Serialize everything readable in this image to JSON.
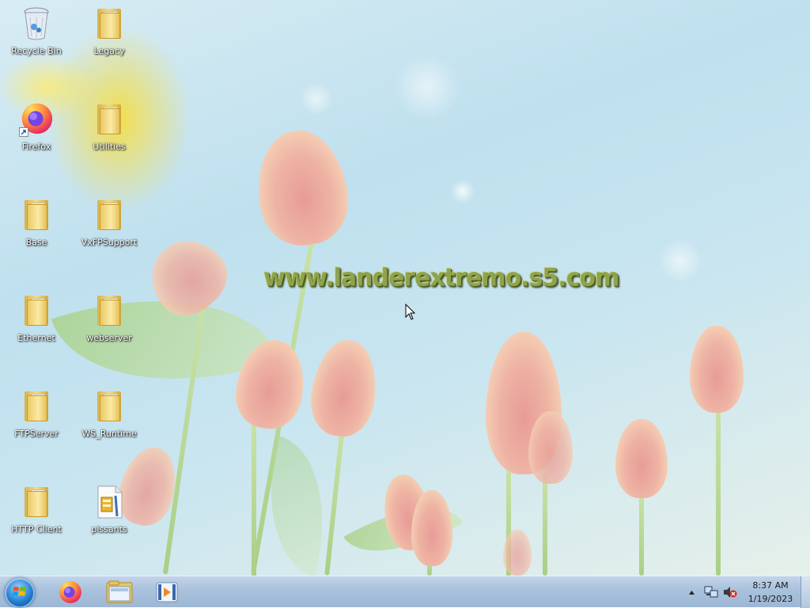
{
  "desktop": {
    "watermark": "www.landerextremo.s5.com",
    "icons": [
      {
        "label": "Recycle Bin",
        "icon": "recycle-bin-icon"
      },
      {
        "label": "Legacy",
        "icon": "folder-icon"
      },
      {
        "label": "Firefox",
        "icon": "firefox-icon"
      },
      {
        "label": "Utilities",
        "icon": "folder-icon"
      },
      {
        "label": "Base",
        "icon": "folder-icon"
      },
      {
        "label": "VxFPSupport",
        "icon": "folder-icon"
      },
      {
        "label": "Ethernet",
        "icon": "folder-icon"
      },
      {
        "label": "webserver",
        "icon": "folder-icon"
      },
      {
        "label": "FTPServer",
        "icon": "folder-icon"
      },
      {
        "label": "WS_Runtime",
        "icon": "folder-icon"
      },
      {
        "label": "HTTP Client",
        "icon": "folder-icon"
      },
      {
        "label": "pissants",
        "icon": "archive-file-icon"
      }
    ]
  },
  "taskbar": {
    "pinned": [
      {
        "name": "firefox",
        "icon": "firefox-icon"
      },
      {
        "name": "file-explorer",
        "icon": "file-explorer-icon"
      },
      {
        "name": "media-player",
        "icon": "media-player-icon"
      }
    ],
    "tray_icons": [
      "show-hidden-icons-arrow",
      "network-icon",
      "volume-muted-icon"
    ],
    "clock": {
      "time": "8:37 AM",
      "date": "1/19/2023"
    }
  },
  "colors": {
    "taskbar": "#a9c1dc",
    "sky": "#bfe0ee",
    "tulip": "#e79c96",
    "watermark": "#8fa34c"
  }
}
